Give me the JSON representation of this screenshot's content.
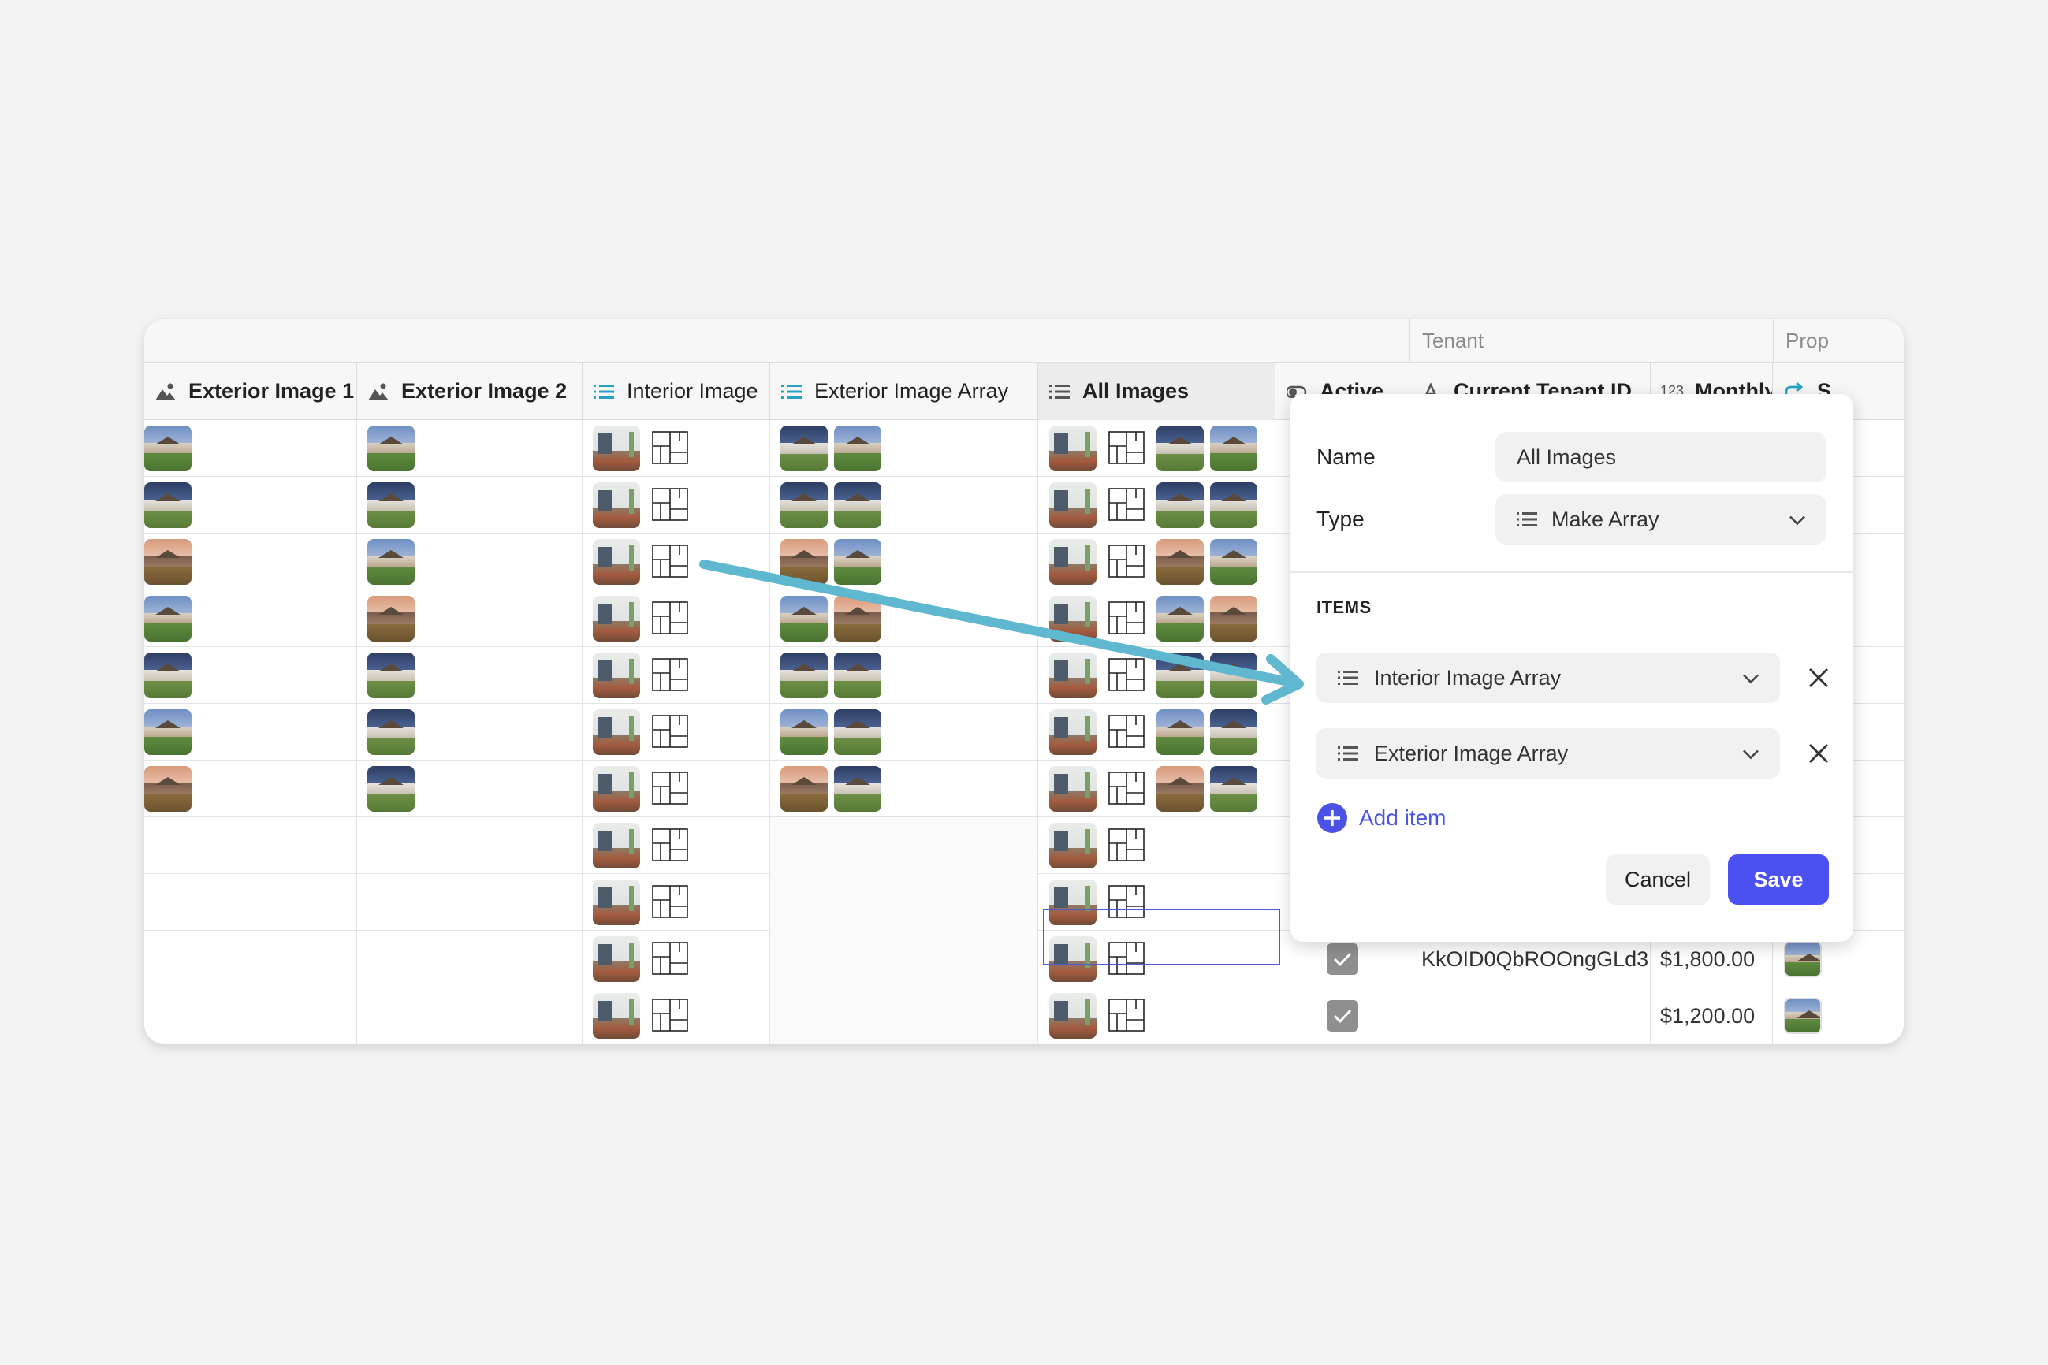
{
  "groups": {
    "tenant": "Tenant",
    "property": "Prop"
  },
  "columns": {
    "exterior_image_1": "Exterior Image 1",
    "exterior_image_2": "Exterior Image 2",
    "interior_image": "Interior Image",
    "exterior_image_array": "Exterior Image Array",
    "all_images": "All Images",
    "active": "Active",
    "current_tenant_id": "Current Tenant ID",
    "monthly_rent": "Monthly rent",
    "property": "S",
    "number_icon": "123"
  },
  "rows": [
    {
      "tenant_id": "",
      "rent": ""
    },
    {
      "tenant_id": "",
      "rent": ""
    },
    {
      "tenant_id": "",
      "rent": ""
    },
    {
      "tenant_id": "",
      "rent": ""
    },
    {
      "tenant_id": "",
      "rent": ""
    },
    {
      "tenant_id": "",
      "rent": ""
    },
    {
      "tenant_id": "",
      "rent": ""
    },
    {
      "tenant_id": "",
      "rent": ""
    },
    {
      "tenant_id": "",
      "rent": ""
    },
    {
      "tenant_id": "KkOID0QbROOngGLd3",
      "rent": "$1,800.00"
    },
    {
      "tenant_id": "",
      "rent": "$1,200.00"
    }
  ],
  "panel": {
    "name_label": "Name",
    "name_value": "All Images",
    "type_label": "Type",
    "type_value": "Make Array",
    "items_title": "ITEMS",
    "items": [
      {
        "label": "Interior Image Array"
      },
      {
        "label": "Exterior Image Array"
      }
    ],
    "add_item": "Add item",
    "cancel": "Cancel",
    "save": "Save"
  },
  "colors": {
    "accent": "#4b50f0",
    "arrow": "#5fb8cf",
    "selection": "#4f5bd5"
  }
}
